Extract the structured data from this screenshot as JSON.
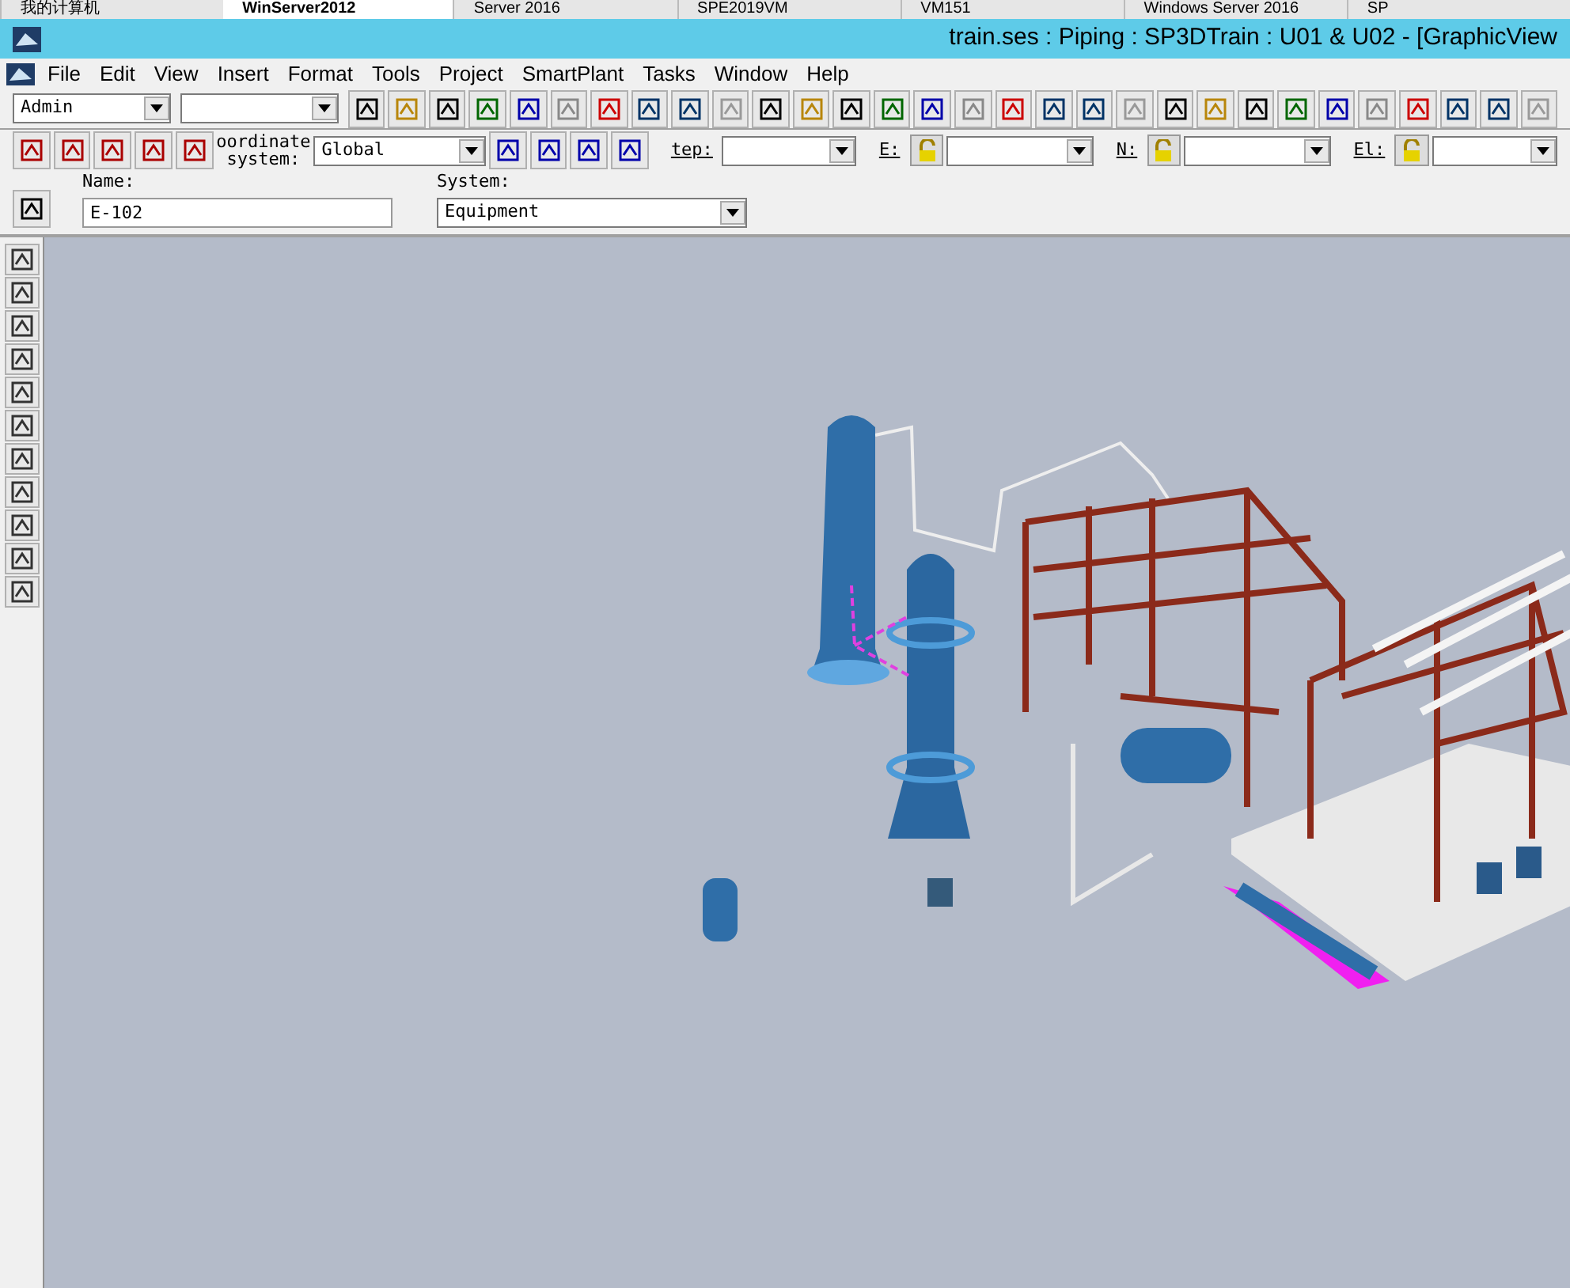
{
  "host_tabs": [
    {
      "label": "我的计算机",
      "selected": false
    },
    {
      "label": "WinServer2012",
      "selected": true
    },
    {
      "label": "Server 2016",
      "selected": false
    },
    {
      "label": "SPE2019VM",
      "selected": false
    },
    {
      "label": "VM151",
      "selected": false
    },
    {
      "label": "Windows Server 2016",
      "selected": false
    },
    {
      "label": "SP",
      "selected": false
    }
  ],
  "window": {
    "title": "train.ses : Piping : SP3DTrain : U01 & U02 - [GraphicView"
  },
  "menu": [
    "File",
    "Edit",
    "View",
    "Insert",
    "Format",
    "Tools",
    "Project",
    "SmartPlant",
    "Tasks",
    "Window",
    "Help"
  ],
  "toolbar": {
    "role": "Admin"
  },
  "placement_bar": {
    "coordinate_label": "oordinate system:",
    "coordinate_system": "Global",
    "step_label": "tep:",
    "e_label": "E:",
    "n_label": "N:",
    "el_label": "El:"
  },
  "properties_bar": {
    "name_label": "Name:",
    "name": "E-102",
    "system_label": "System:",
    "system": "Equipment"
  }
}
